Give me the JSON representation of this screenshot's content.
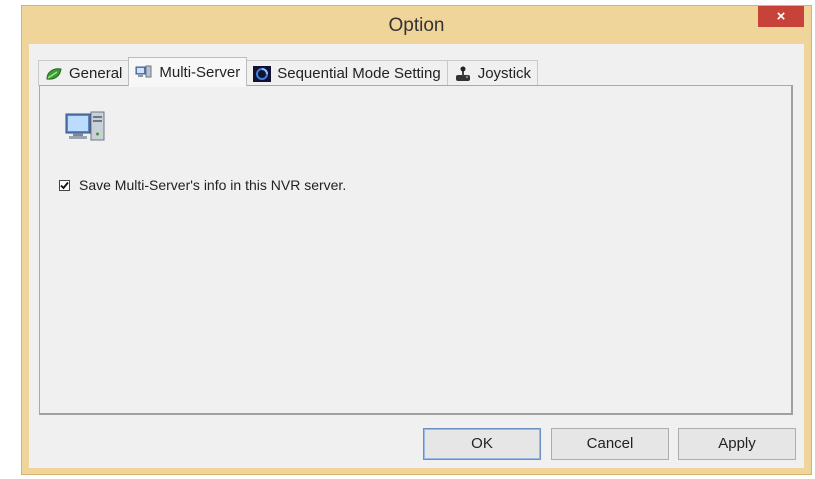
{
  "window": {
    "title": "Option",
    "close_label": "×"
  },
  "tabs": [
    {
      "label": "General",
      "icon": "green-leaf-icon",
      "active": false
    },
    {
      "label": "Multi-Server",
      "icon": "multi-server-icon",
      "active": true
    },
    {
      "label": "Sequential Mode Setting",
      "icon": "sequential-mode-icon",
      "active": false
    },
    {
      "label": "Joystick",
      "icon": "joystick-icon",
      "active": false
    }
  ],
  "panel": {
    "icon": "computer-server-icon",
    "checkbox": {
      "label": "Save Multi-Server's info in this NVR server.",
      "checked": true
    }
  },
  "buttons": {
    "ok": "OK",
    "cancel": "Cancel",
    "apply": "Apply"
  },
  "colors": {
    "title_bar": "#f0d59a",
    "close_button": "#c7433a",
    "client_bg": "#f0f0f0"
  }
}
